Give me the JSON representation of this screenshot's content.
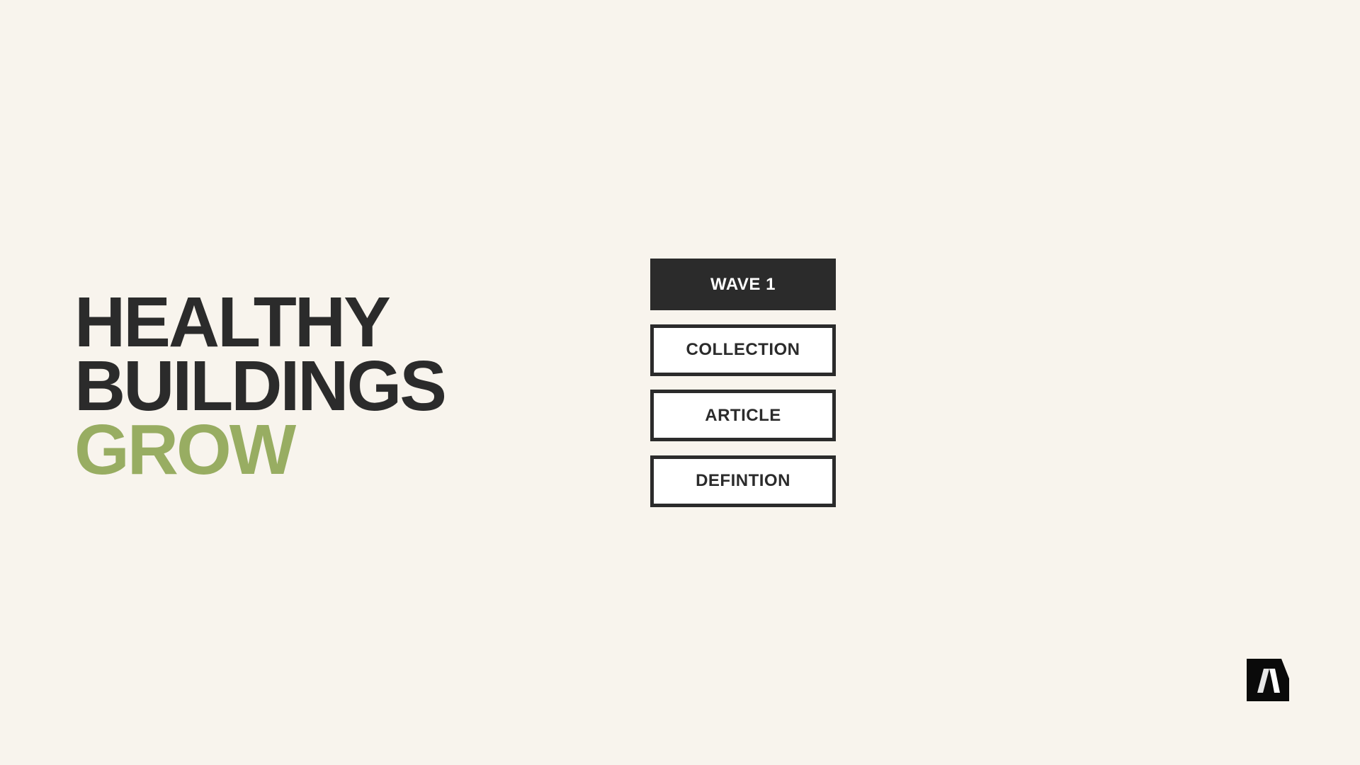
{
  "headline": {
    "line1": "HEALTHY",
    "line2": "BUILDINGS",
    "line3": "GROW"
  },
  "menu": {
    "items": [
      {
        "label": "WAVE 1",
        "active": true
      },
      {
        "label": "COLLECTION",
        "active": false
      },
      {
        "label": "ARTICLE",
        "active": false
      },
      {
        "label": "DEFINTION",
        "active": false
      }
    ]
  },
  "colors": {
    "background": "#f8f4ed",
    "text_dark": "#2b2b2b",
    "accent_green": "#98ad62",
    "logo_black": "#0a0a0a"
  },
  "logo": {
    "icon": "brand-logo-a-icon"
  }
}
